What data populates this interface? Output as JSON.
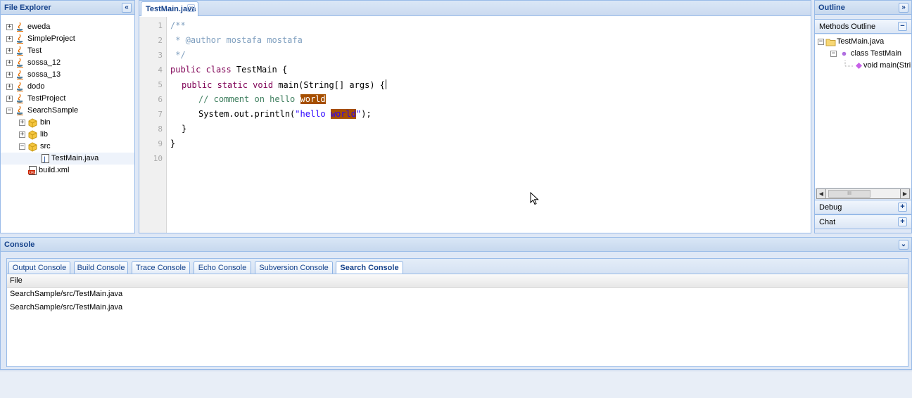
{
  "explorer": {
    "title": "File Explorer",
    "collapse": "«",
    "items": [
      {
        "label": "eweda"
      },
      {
        "label": "SimpleProject"
      },
      {
        "label": "Test"
      },
      {
        "label": "sossa_12"
      },
      {
        "label": "sossa_13"
      },
      {
        "label": "dodo"
      },
      {
        "label": "TestProject"
      },
      {
        "label": "SearchSample"
      },
      {
        "label": "bin"
      },
      {
        "label": "lib"
      },
      {
        "label": "src"
      },
      {
        "label": "TestMain.java"
      },
      {
        "label": "build.xml"
      }
    ]
  },
  "editor": {
    "tab_label": "TestMain.java",
    "line_numbers": [
      "1",
      "2",
      "3",
      "4",
      "5",
      "6",
      "7",
      "8",
      "9",
      "10"
    ],
    "code": {
      "l1": "/**",
      "l2": " * @author mostafa mostafa",
      "l3": " */",
      "l4_kw": "public class",
      "l4_rest": " TestMain {",
      "l5_kw": "public static void",
      "l5_rest": " main(String[] args) {",
      "l6_comment": "// comment on hello ",
      "l6_match": "world",
      "l7_pre": "System.out.println(",
      "l7_str": "\"hello ",
      "l7_match": "world",
      "l7_end_str": "\"",
      "l7_post": ");",
      "l8": "}",
      "l9": "}"
    }
  },
  "outline": {
    "title": "Outline",
    "expand": "»",
    "methods_outline": "Methods Outline",
    "tree": [
      {
        "label": "TestMain.java"
      },
      {
        "label": "class TestMain"
      },
      {
        "label": "void main(Strin"
      }
    ],
    "scroll_thumb": "III",
    "debug": "Debug",
    "chat": "Chat"
  },
  "console": {
    "title": "Console",
    "tabs": [
      "Output Console",
      "Build Console",
      "Trace Console",
      "Echo Console",
      "Subversion Console",
      "Search Console"
    ],
    "active_tab": "Search Console",
    "column_header": "File",
    "rows": [
      "SearchSample/src/TestMain.java",
      "SearchSample/src/TestMain.java"
    ]
  }
}
